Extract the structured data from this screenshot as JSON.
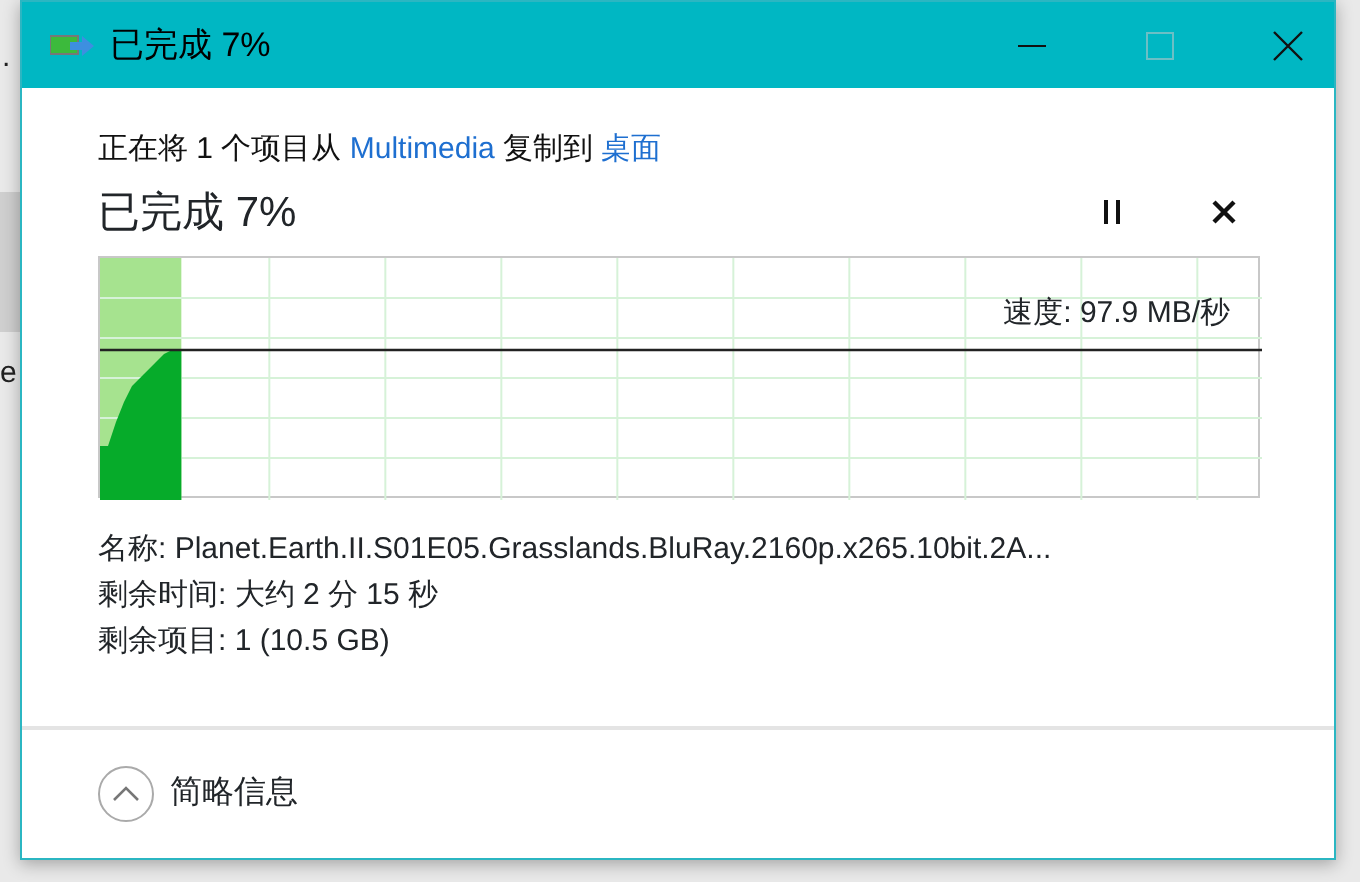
{
  "background_fragments": [
    ".",
    "e"
  ],
  "window": {
    "title": "已完成 7%"
  },
  "header": {
    "prefix": "正在将 1 个项目从",
    "source": "Multimedia",
    "middle": "复制到",
    "destination": "桌面"
  },
  "heading": "已完成 7%",
  "progress": {
    "level": 0.07,
    "speed": "速度: 97.9 MB/秒"
  },
  "details": [
    {
      "label": "名称:",
      "value": "Planet.Earth.II.S01E05.Grasslands.BluRay.2160p.x265.10bit.2A..."
    },
    {
      "label": "剩余时间:",
      "value": "大约 2 分 15 秒"
    },
    {
      "label": "剩余项目:",
      "value": "1 (10.5 GB)"
    }
  ],
  "footer": {
    "toggle": "简略信息",
    "expanded": true
  }
}
